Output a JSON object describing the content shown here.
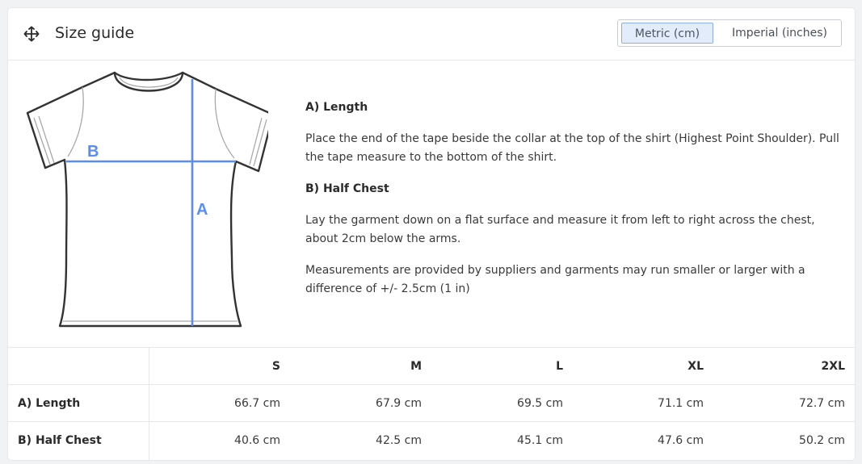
{
  "header": {
    "title": "Size guide",
    "icon": "move-icon"
  },
  "units": {
    "metric_label": "Metric (cm)",
    "imperial_label": "Imperial (inches)",
    "selected": "Metric (cm)"
  },
  "diagram": {
    "label_a": "A",
    "label_b": "B",
    "accent_color": "#5b8def"
  },
  "info": {
    "length_title": "A) Length",
    "length_text": "Place the end of the tape beside the collar at the top of the shirt (Highest Point Shoulder). Pull the tape measure to the bottom of the shirt.",
    "chest_title": "B) Half Chest",
    "chest_text": "Lay the garment down on a flat surface and measure it from left to right across the chest, about 2cm below the arms.",
    "note": "Measurements are provided by suppliers and garments may run smaller or larger with a difference of +/- 2.5cm (1 in)"
  },
  "table": {
    "sizes": [
      "S",
      "M",
      "L",
      "XL",
      "2XL"
    ],
    "rows": [
      {
        "label": "A) Length",
        "values": [
          "66.7 cm",
          "67.9 cm",
          "69.5 cm",
          "71.1 cm",
          "72.7 cm"
        ]
      },
      {
        "label": "B) Half Chest",
        "values": [
          "40.6 cm",
          "42.5 cm",
          "45.1 cm",
          "47.6 cm",
          "50.2 cm"
        ]
      }
    ]
  }
}
